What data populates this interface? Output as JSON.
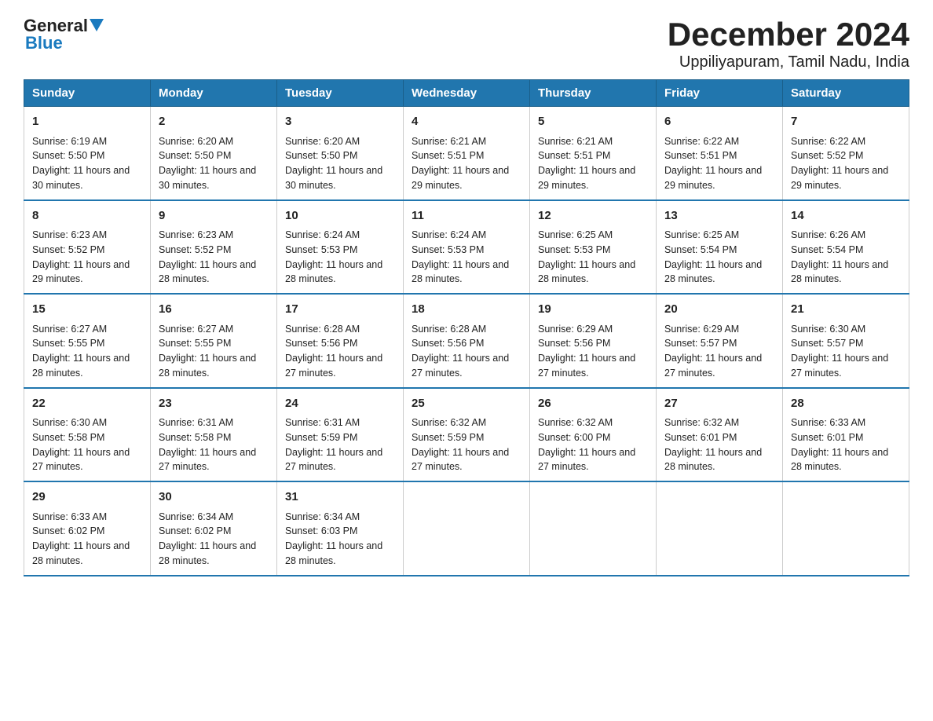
{
  "logo": {
    "text_general": "General",
    "text_blue": "Blue"
  },
  "title": "December 2024",
  "subtitle": "Uppiliyapuram, Tamil Nadu, India",
  "weekdays": [
    "Sunday",
    "Monday",
    "Tuesday",
    "Wednesday",
    "Thursday",
    "Friday",
    "Saturday"
  ],
  "weeks": [
    [
      {
        "day": "1",
        "sunrise": "6:19 AM",
        "sunset": "5:50 PM",
        "daylight": "11 hours and 30 minutes."
      },
      {
        "day": "2",
        "sunrise": "6:20 AM",
        "sunset": "5:50 PM",
        "daylight": "11 hours and 30 minutes."
      },
      {
        "day": "3",
        "sunrise": "6:20 AM",
        "sunset": "5:50 PM",
        "daylight": "11 hours and 30 minutes."
      },
      {
        "day": "4",
        "sunrise": "6:21 AM",
        "sunset": "5:51 PM",
        "daylight": "11 hours and 29 minutes."
      },
      {
        "day": "5",
        "sunrise": "6:21 AM",
        "sunset": "5:51 PM",
        "daylight": "11 hours and 29 minutes."
      },
      {
        "day": "6",
        "sunrise": "6:22 AM",
        "sunset": "5:51 PM",
        "daylight": "11 hours and 29 minutes."
      },
      {
        "day": "7",
        "sunrise": "6:22 AM",
        "sunset": "5:52 PM",
        "daylight": "11 hours and 29 minutes."
      }
    ],
    [
      {
        "day": "8",
        "sunrise": "6:23 AM",
        "sunset": "5:52 PM",
        "daylight": "11 hours and 29 minutes."
      },
      {
        "day": "9",
        "sunrise": "6:23 AM",
        "sunset": "5:52 PM",
        "daylight": "11 hours and 28 minutes."
      },
      {
        "day": "10",
        "sunrise": "6:24 AM",
        "sunset": "5:53 PM",
        "daylight": "11 hours and 28 minutes."
      },
      {
        "day": "11",
        "sunrise": "6:24 AM",
        "sunset": "5:53 PM",
        "daylight": "11 hours and 28 minutes."
      },
      {
        "day": "12",
        "sunrise": "6:25 AM",
        "sunset": "5:53 PM",
        "daylight": "11 hours and 28 minutes."
      },
      {
        "day": "13",
        "sunrise": "6:25 AM",
        "sunset": "5:54 PM",
        "daylight": "11 hours and 28 minutes."
      },
      {
        "day": "14",
        "sunrise": "6:26 AM",
        "sunset": "5:54 PM",
        "daylight": "11 hours and 28 minutes."
      }
    ],
    [
      {
        "day": "15",
        "sunrise": "6:27 AM",
        "sunset": "5:55 PM",
        "daylight": "11 hours and 28 minutes."
      },
      {
        "day": "16",
        "sunrise": "6:27 AM",
        "sunset": "5:55 PM",
        "daylight": "11 hours and 28 minutes."
      },
      {
        "day": "17",
        "sunrise": "6:28 AM",
        "sunset": "5:56 PM",
        "daylight": "11 hours and 27 minutes."
      },
      {
        "day": "18",
        "sunrise": "6:28 AM",
        "sunset": "5:56 PM",
        "daylight": "11 hours and 27 minutes."
      },
      {
        "day": "19",
        "sunrise": "6:29 AM",
        "sunset": "5:56 PM",
        "daylight": "11 hours and 27 minutes."
      },
      {
        "day": "20",
        "sunrise": "6:29 AM",
        "sunset": "5:57 PM",
        "daylight": "11 hours and 27 minutes."
      },
      {
        "day": "21",
        "sunrise": "6:30 AM",
        "sunset": "5:57 PM",
        "daylight": "11 hours and 27 minutes."
      }
    ],
    [
      {
        "day": "22",
        "sunrise": "6:30 AM",
        "sunset": "5:58 PM",
        "daylight": "11 hours and 27 minutes."
      },
      {
        "day": "23",
        "sunrise": "6:31 AM",
        "sunset": "5:58 PM",
        "daylight": "11 hours and 27 minutes."
      },
      {
        "day": "24",
        "sunrise": "6:31 AM",
        "sunset": "5:59 PM",
        "daylight": "11 hours and 27 minutes."
      },
      {
        "day": "25",
        "sunrise": "6:32 AM",
        "sunset": "5:59 PM",
        "daylight": "11 hours and 27 minutes."
      },
      {
        "day": "26",
        "sunrise": "6:32 AM",
        "sunset": "6:00 PM",
        "daylight": "11 hours and 27 minutes."
      },
      {
        "day": "27",
        "sunrise": "6:32 AM",
        "sunset": "6:01 PM",
        "daylight": "11 hours and 28 minutes."
      },
      {
        "day": "28",
        "sunrise": "6:33 AM",
        "sunset": "6:01 PM",
        "daylight": "11 hours and 28 minutes."
      }
    ],
    [
      {
        "day": "29",
        "sunrise": "6:33 AM",
        "sunset": "6:02 PM",
        "daylight": "11 hours and 28 minutes."
      },
      {
        "day": "30",
        "sunrise": "6:34 AM",
        "sunset": "6:02 PM",
        "daylight": "11 hours and 28 minutes."
      },
      {
        "day": "31",
        "sunrise": "6:34 AM",
        "sunset": "6:03 PM",
        "daylight": "11 hours and 28 minutes."
      },
      null,
      null,
      null,
      null
    ]
  ]
}
